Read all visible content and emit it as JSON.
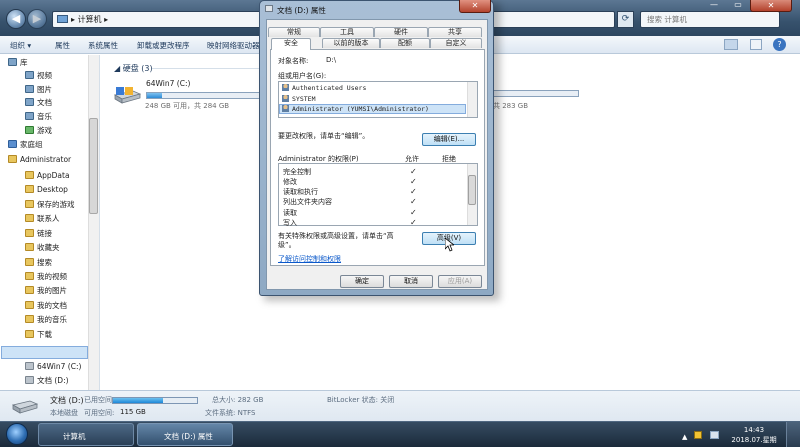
{
  "explorer": {
    "breadcrumb": "计算机",
    "breadcrumb_sep": "▸",
    "search_placeholder": "搜索 计算机",
    "window_buttons": {
      "min": "—",
      "max": "▭",
      "close": "✕"
    },
    "toolbar": [
      {
        "label": "组织 ▾"
      },
      {
        "label": "属性"
      },
      {
        "label": "系统属性"
      },
      {
        "label": "卸载或更改程序"
      },
      {
        "label": "映射网络驱动器"
      }
    ],
    "nav": [
      {
        "label": "库",
        "icon": "library-icon",
        "indent": 0
      },
      {
        "label": "视频",
        "icon": "video-library-icon",
        "indent": 1
      },
      {
        "label": "图片",
        "icon": "pictures-library-icon",
        "indent": 1
      },
      {
        "label": "文档",
        "icon": "documents-library-icon",
        "indent": 1
      },
      {
        "label": "音乐",
        "icon": "music-library-icon",
        "indent": 1
      },
      {
        "label": "游戏",
        "icon": "games-icon",
        "indent": 1
      },
      {
        "label": "家庭组",
        "icon": "homegroup-icon",
        "indent": 0
      },
      {
        "label": "Administrator",
        "icon": "user-folder-icon",
        "indent": 0
      },
      {
        "label": "AppData",
        "icon": "folder-icon",
        "indent": 1
      },
      {
        "label": "Desktop",
        "icon": "folder-icon",
        "indent": 1
      },
      {
        "label": "保存的游戏",
        "icon": "folder-icon",
        "indent": 1
      },
      {
        "label": "联系人",
        "icon": "folder-icon",
        "indent": 1
      },
      {
        "label": "链接",
        "icon": "folder-icon",
        "indent": 1
      },
      {
        "label": "收藏夹",
        "icon": "folder-icon",
        "indent": 1
      },
      {
        "label": "搜索",
        "icon": "folder-icon",
        "indent": 1
      },
      {
        "label": "我的视频",
        "icon": "folder-icon",
        "indent": 1
      },
      {
        "label": "我的图片",
        "icon": "folder-icon",
        "indent": 1
      },
      {
        "label": "我的文档",
        "icon": "folder-icon",
        "indent": 1
      },
      {
        "label": "我的音乐",
        "icon": "folder-icon",
        "indent": 1
      },
      {
        "label": "下载",
        "icon": "folder-icon",
        "indent": 1
      },
      {
        "label": "计算机",
        "icon": "computer-icon",
        "indent": 0
      },
      {
        "label": "64Win7  (C:)",
        "icon": "drive-icon",
        "indent": 1
      },
      {
        "label": "文档 (D:)",
        "icon": "drive-icon",
        "indent": 1
      },
      {
        "label": "软件 (E:)",
        "icon": "drive-icon",
        "indent": 1
      }
    ],
    "group_label": "硬盘 (3)",
    "drive_c": {
      "name": "64Win7  (C:)",
      "info": "248 GB 可用，共 284 GB",
      "used_fraction": 0.13
    },
    "drive_e_info": "共 283 GB",
    "status": {
      "drive_title": "文档 (D:)",
      "used_label": "已用空间:",
      "type_label": "本地磁盘",
      "free_label": "可用空间:",
      "free_value": "115 GB",
      "total": "总大小: 282 GB",
      "fs": "文件系统: NTFS",
      "bitlocker": "BitLocker 状态: 关闭",
      "used_fraction": 0.59
    }
  },
  "taskbar": {
    "items": [
      {
        "label": "计算机"
      },
      {
        "label": "文档 (D:) 属性"
      }
    ],
    "clock_time": "14:43",
    "clock_date": "2018.07.星期五",
    "tray_arrow": "▲"
  },
  "dialog": {
    "title": "文档 (D:) 属性",
    "close": "✕",
    "tabs_row1": [
      "常规",
      "工具",
      "硬件",
      "共享"
    ],
    "tabs_row2": [
      "安全",
      "以前的版本",
      "配额",
      "自定义"
    ],
    "object_label": "对象名称:",
    "object_value": "D:\\",
    "users_label": "组或用户名(G):",
    "users": [
      "Authenticated Users",
      "SYSTEM",
      "Administrator (YUMSI\\Administrator)"
    ],
    "edit_prompt": "要更改权限，请单击“编辑”。",
    "edit_button": "编辑(E)...",
    "perm_header": "Administrator 的权限(P)",
    "allow": "允许",
    "deny": "拒绝",
    "permissions": [
      {
        "name": "完全控制",
        "allow": true
      },
      {
        "name": "修改",
        "allow": true
      },
      {
        "name": "读取和执行",
        "allow": true
      },
      {
        "name": "列出文件夹内容",
        "allow": true
      },
      {
        "name": "读取",
        "allow": true
      },
      {
        "name": "写入",
        "allow": true
      }
    ],
    "check_glyph": "✓",
    "advanced_prompt_1": "有关特殊权限或高级设置，请单击“高",
    "advanced_prompt_2": "级”。",
    "advanced_button": "高级(V)",
    "link": "了解访问控制和权限",
    "ok": "确定",
    "cancel": "取消",
    "apply": "应用(A)"
  }
}
